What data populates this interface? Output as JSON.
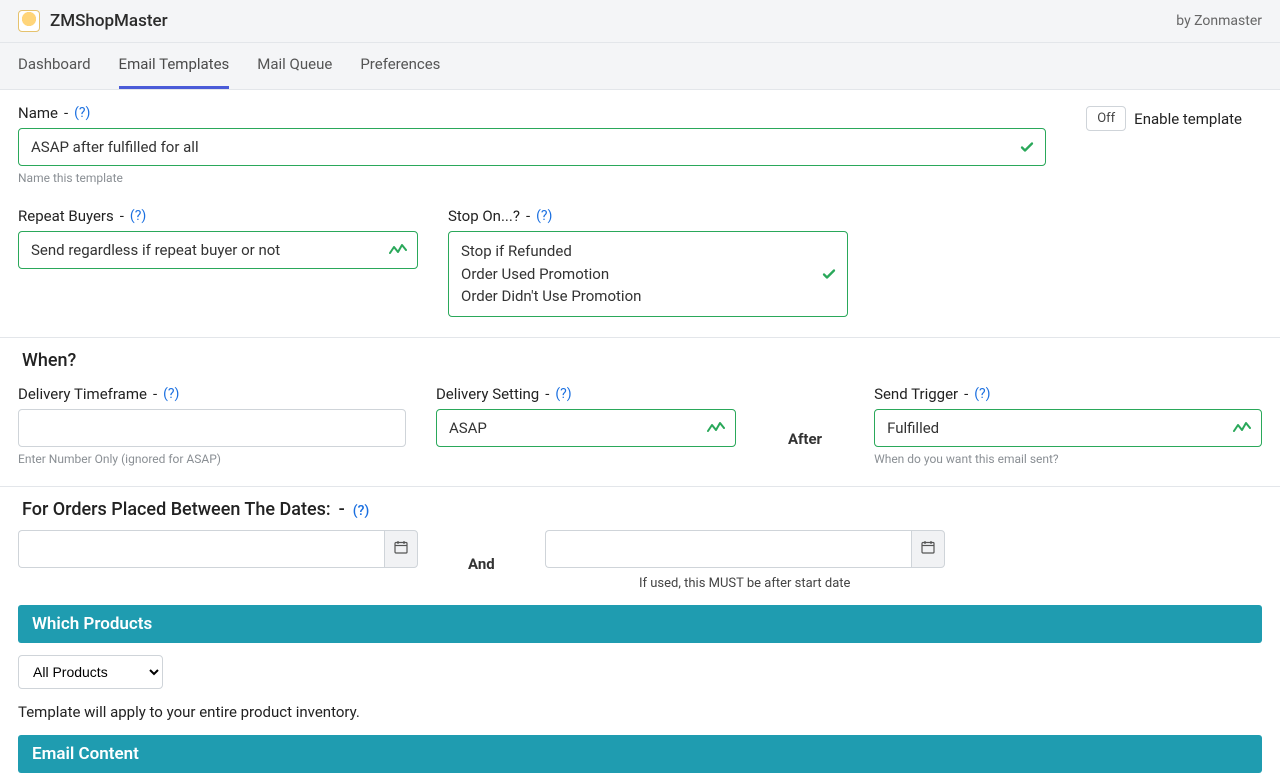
{
  "header": {
    "brand": "ZMShopMaster",
    "by": "by Zonmaster"
  },
  "tabs": {
    "dashboard": "Dashboard",
    "email_templates": "Email Templates",
    "mail_queue": "Mail Queue",
    "preferences": "Preferences"
  },
  "toggle": {
    "state": "Off",
    "label": "Enable template"
  },
  "name": {
    "label": "Name",
    "help": "(?)",
    "value": "ASAP after fulfilled for all",
    "helper": "Name this template"
  },
  "repeat_buyers": {
    "label": "Repeat Buyers",
    "help": "(?)",
    "value": "Send regardless if repeat buyer or not"
  },
  "stop_on": {
    "label": "Stop On...?",
    "help": "(?)",
    "options": [
      "Stop if Refunded",
      "Order Used Promotion",
      "Order Didn't Use Promotion"
    ]
  },
  "when": {
    "title": "When?",
    "timeframe_label": "Delivery Timeframe",
    "timeframe_help": "(?)",
    "timeframe_helper": "Enter Number Only (ignored for ASAP)",
    "setting_label": "Delivery Setting",
    "setting_help": "(?)",
    "setting_value": "ASAP",
    "after": "After",
    "trigger_label": "Send Trigger",
    "trigger_help": "(?)",
    "trigger_value": "Fulfilled",
    "trigger_helper": "When do you want this email sent?"
  },
  "dates": {
    "title": "For Orders Placed Between The Dates:",
    "help": "(?)",
    "and": "And",
    "end_helper": "If used, this MUST be after start date"
  },
  "products": {
    "banner": "Which Products",
    "select_value": "All Products",
    "note": "Template will apply to your entire product inventory."
  },
  "email_content": {
    "banner": "Email Content"
  }
}
